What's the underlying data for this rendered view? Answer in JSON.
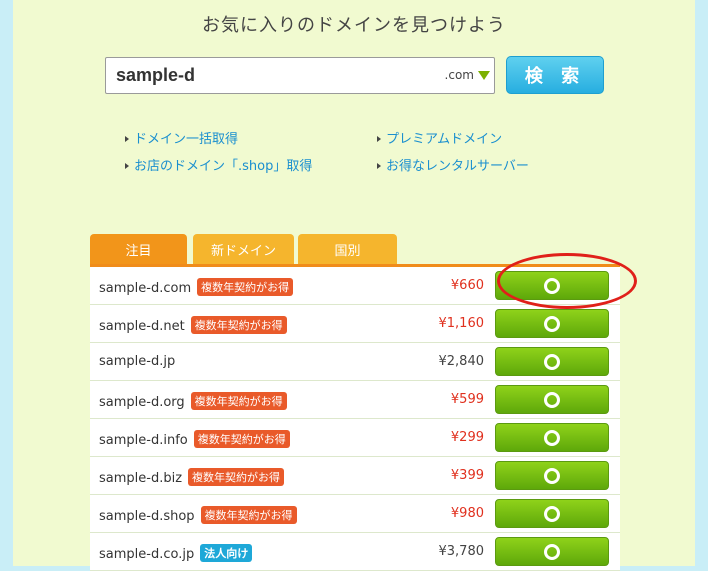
{
  "header": {
    "title": "お気に入りのドメインを見つけよう"
  },
  "search": {
    "value": "sample-d",
    "tld": ".com",
    "button_label": "検 索"
  },
  "links": [
    "ドメイン一括取得",
    "プレミアムドメイン",
    "お店のドメイン「.shop」取得",
    "お得なレンタルサーバー"
  ],
  "tabs": [
    "注目",
    "新ドメイン",
    "国別"
  ],
  "results": [
    {
      "domain": "sample-d.com",
      "badge": "複数年契約がお得",
      "badge_type": "red",
      "price": "¥660",
      "price_color": "red"
    },
    {
      "domain": "sample-d.net",
      "badge": "複数年契約がお得",
      "badge_type": "red",
      "price": "¥1,160",
      "price_color": "red"
    },
    {
      "domain": "sample-d.jp",
      "badge": "",
      "badge_type": "none",
      "price": "¥2,840",
      "price_color": "gray"
    },
    {
      "domain": "sample-d.org",
      "badge": "複数年契約がお得",
      "badge_type": "red",
      "price": "¥599",
      "price_color": "red"
    },
    {
      "domain": "sample-d.info",
      "badge": "複数年契約がお得",
      "badge_type": "red",
      "price": "¥299",
      "price_color": "red"
    },
    {
      "domain": "sample-d.biz",
      "badge": "複数年契約がお得",
      "badge_type": "red",
      "price": "¥399",
      "price_color": "red"
    },
    {
      "domain": "sample-d.shop",
      "badge": "複数年契約がお得",
      "badge_type": "red",
      "price": "¥980",
      "price_color": "red"
    },
    {
      "domain": "sample-d.co.jp",
      "badge": "法人向け",
      "badge_type": "blue",
      "price": "¥3,780",
      "price_color": "gray"
    }
  ],
  "colors": {
    "accent_orange": "#f2951a",
    "button_green": "#6cb50f",
    "search_blue": "#27aee0",
    "price_red": "#e0301e",
    "highlight_red": "#e0201a"
  }
}
